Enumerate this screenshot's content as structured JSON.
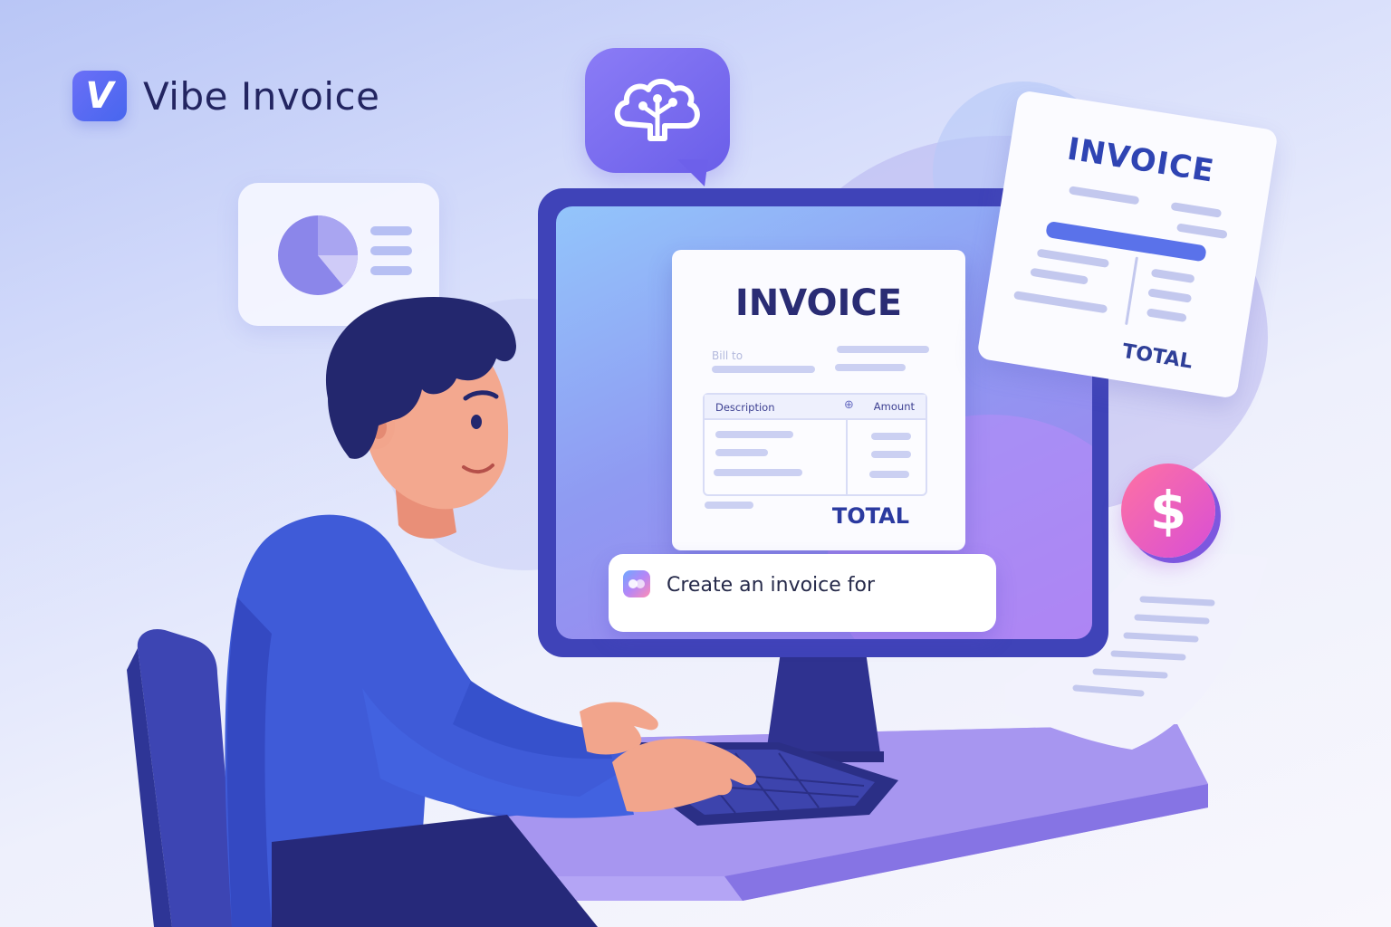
{
  "brand": {
    "mark_letter": "V",
    "name": "Vibe Invoice"
  },
  "screen_invoice": {
    "title": "INVOICE",
    "bill_to_label": "Bill to",
    "table_header_description": "Description",
    "table_header_add_icon": "plus-circle-icon",
    "table_header_amount": "Amount",
    "total_label": "TOTAL"
  },
  "prompt": {
    "icon": "ai-sparkle-icon",
    "text": "Create an invoice for"
  },
  "floating_invoice": {
    "title": "INVOICE",
    "total_label": "TOTAL"
  },
  "coin": {
    "symbol": "$"
  },
  "chat_bubble": {
    "icon": "brain-tree-icon"
  },
  "chart_card": {
    "icon": "pie-chart-icon"
  },
  "colors": {
    "brand_blue": "#4766ee",
    "monitor_frame": "#3f43b8",
    "shirt_blue": "#3f5bd8",
    "accent_purple": "#6a5ee9",
    "coin_pink": "#ff72a2"
  }
}
